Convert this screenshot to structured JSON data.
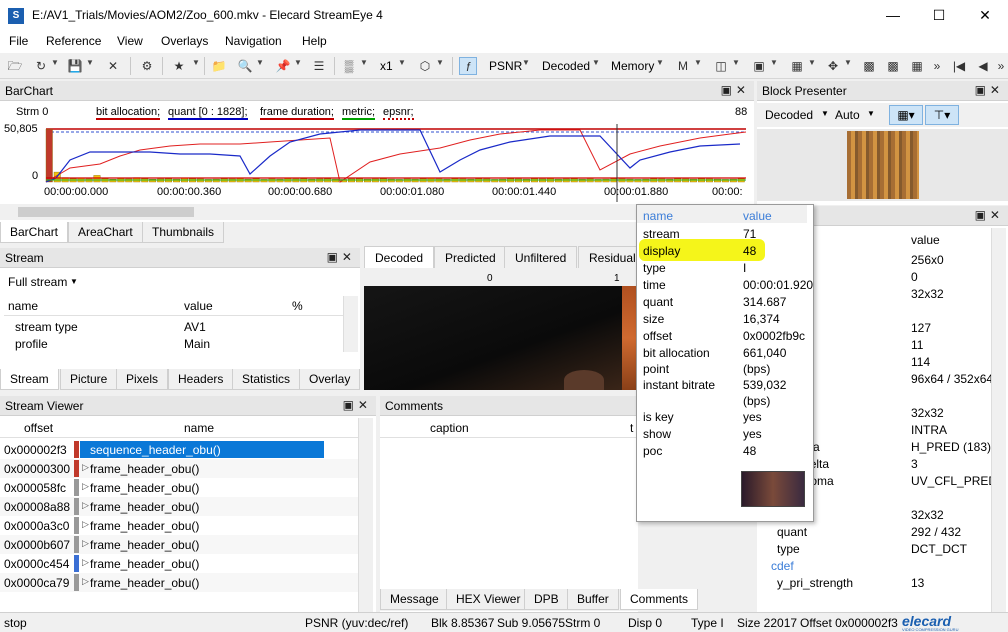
{
  "window": {
    "title": "E:/AV1_Trials/Movies/AOM2/Zoo_600.mkv - Elecard StreamEye 4",
    "icon_name": "app-icon"
  },
  "menu": [
    "File",
    "Reference",
    "View",
    "Overlays",
    "Navigation",
    "Help"
  ],
  "toolbar": {
    "multiplier": "x1",
    "psnr": "PSNR",
    "decoded": "Decoded",
    "memory": "Memory"
  },
  "barchart": {
    "title": "BarChart",
    "strm_label": "Strm 0",
    "right_count": "88",
    "ymax": "50,805",
    "yzero": "0",
    "legend": [
      {
        "text": "bit allocation;",
        "color": "#c00000"
      },
      {
        "text": "quant [0 : 1828];",
        "color": "#0000c0"
      },
      {
        "text": "frame duration;",
        "color": "#c00000"
      },
      {
        "text": "metric;",
        "color": "#00a000"
      },
      {
        "text": "epsnr;",
        "color": "#c00000"
      }
    ],
    "ticks": [
      "00:00:00.000",
      "00:00:00.360",
      "00:00:00.680",
      "00:00:01.080",
      "00:00:01.440",
      "00:00:01.880",
      "00:00:"
    ],
    "tabs": [
      "BarChart",
      "AreaChart",
      "Thumbnails"
    ]
  },
  "chart_data": {
    "type": "bar",
    "title": "",
    "series": [
      {
        "name": "bit allocation",
        "values": [
          48000,
          9000,
          4000,
          3000,
          3500,
          2800,
          6000,
          3000,
          2500,
          3200,
          2800,
          4000,
          3000,
          2500,
          2800,
          3000,
          2600,
          3500,
          3000,
          2800,
          2400,
          2600,
          3000,
          2800,
          3200,
          2600,
          3000,
          2400,
          2800,
          2600,
          3200,
          2800,
          3000,
          2600,
          2800,
          3000,
          2600,
          2400,
          2800,
          3000,
          2600,
          2800,
          3000,
          2600,
          2400,
          2800,
          2600,
          3000,
          3800,
          2800,
          2600,
          3000,
          2800,
          2600,
          3000,
          2800,
          2400,
          2600,
          3000,
          2800,
          2600,
          3000,
          2800,
          3200,
          2600,
          2800,
          3000,
          2600,
          2800,
          2400,
          2600,
          3000,
          2800,
          2600,
          2400,
          2600,
          3000,
          2800,
          2600,
          3000,
          2800,
          2600,
          3000,
          2800,
          2600,
          2400,
          2600,
          3000
        ]
      }
    ],
    "ylim": [
      0,
      50805
    ]
  },
  "block_presenter": {
    "title": "Block Presenter",
    "mode": "Decoded",
    "scale": "Auto"
  },
  "stream": {
    "title": "Stream",
    "selector": "Full stream",
    "headers": [
      "name",
      "value",
      "%"
    ],
    "rows": [
      {
        "name": "stream type",
        "value": "AV1"
      },
      {
        "name": "profile",
        "value": "Main"
      }
    ],
    "tabs": [
      "Stream",
      "Picture",
      "Pixels",
      "Headers",
      "Statistics",
      "Overlay"
    ]
  },
  "picture_tabs": [
    "Decoded",
    "Predicted",
    "Unfiltered",
    "Residual"
  ],
  "picture_ruler": {
    "left": "0",
    "right": "1"
  },
  "stream_viewer": {
    "title": "Stream Viewer",
    "headers": [
      "offset",
      "name"
    ],
    "rows": [
      {
        "offset": "0x000002f3",
        "name": "sequence_header_obu()",
        "marker": "#c0392b"
      },
      {
        "offset": "0x00000300",
        "name": "frame_header_obu()",
        "marker": "#c0392b"
      },
      {
        "offset": "0x000058fc",
        "name": "frame_header_obu()",
        "marker": "#999999"
      },
      {
        "offset": "0x00008a88",
        "name": "frame_header_obu()",
        "marker": "#999999"
      },
      {
        "offset": "0x0000a3c0",
        "name": "frame_header_obu()",
        "marker": "#999999"
      },
      {
        "offset": "0x0000b607",
        "name": "frame_header_obu()",
        "marker": "#999999"
      },
      {
        "offset": "0x0000c454",
        "name": "frame_header_obu()",
        "marker": "#3b6fd4"
      },
      {
        "offset": "0x0000ca79",
        "name": "frame_header_obu()",
        "marker": "#999999"
      }
    ]
  },
  "comments": {
    "title": "Comments",
    "headers": [
      "caption",
      "t"
    ],
    "tabs": [
      "Message",
      "HEX Viewer",
      "DPB",
      "Buffer",
      "Comments"
    ]
  },
  "right_panel": {
    "header_value": "value",
    "rows": [
      {
        "name": "ation",
        "value": "256x0"
      },
      {
        "name": "",
        "value": "0"
      },
      {
        "name": "ion",
        "value": "32x32"
      },
      {
        "name": "",
        "value": ""
      },
      {
        "name": "",
        "value": "127"
      },
      {
        "name": "ction",
        "value": "11"
      },
      {
        "name": "orm",
        "value": "114"
      },
      {
        "name": "",
        "value": "96x64 / 352x64"
      },
      {
        "name": "on",
        "value": "",
        "link": true
      },
      {
        "name": "ion",
        "value": "32x32"
      },
      {
        "name": "",
        "value": "INTRA"
      },
      {
        "name": "pe luma",
        "value": "H_PRED (183)"
      },
      {
        "name": "ngle delta",
        "value": "3"
      },
      {
        "name": "pe chroma",
        "value": "UV_CFL_PRED"
      },
      {
        "name": "n",
        "value": "",
        "link": true
      },
      {
        "name": "ion",
        "value": "32x32"
      },
      {
        "name": "quant",
        "value": "292 / 432"
      },
      {
        "name": "type",
        "value": "DCT_DCT"
      },
      {
        "name": "cdef",
        "value": "",
        "link": true
      },
      {
        "name": "y_pri_strength",
        "value": "13"
      }
    ]
  },
  "popup": {
    "header": {
      "name": "name",
      "value": "value"
    },
    "rows": [
      {
        "k": "stream",
        "v": "71"
      },
      {
        "k": "display",
        "v": "48",
        "highlight": true
      },
      {
        "k": "type",
        "v": "I"
      },
      {
        "k": "time",
        "v": "00:00:01.920"
      },
      {
        "k": "quant",
        "v": "314.687"
      },
      {
        "k": "size",
        "v": "16,374"
      },
      {
        "k": "offset",
        "v": "0x0002fb9c"
      },
      {
        "k": "bit allocation",
        "v": "661,040"
      },
      {
        "k": "point",
        "v": "(bps)"
      },
      {
        "k": "instant bitrate",
        "v": "539,032"
      },
      {
        "k": "",
        "v": "(bps)"
      },
      {
        "k": "is key",
        "v": "yes"
      },
      {
        "k": "show",
        "v": "yes"
      },
      {
        "k": "poc",
        "v": "48"
      }
    ]
  },
  "status": {
    "left": "stop",
    "psnr": "PSNR (yuv:dec/ref)",
    "blk": "Blk 8.85367",
    "sub": "Sub 9.05675",
    "strm": "Strm 0",
    "disp": "Disp 0",
    "type": "Type I",
    "size": "Size 22017",
    "offset": "Offset 0x000002f3",
    "brand": "elecard",
    "brand_sub": "VIDEO COMPRESSION GURU"
  }
}
